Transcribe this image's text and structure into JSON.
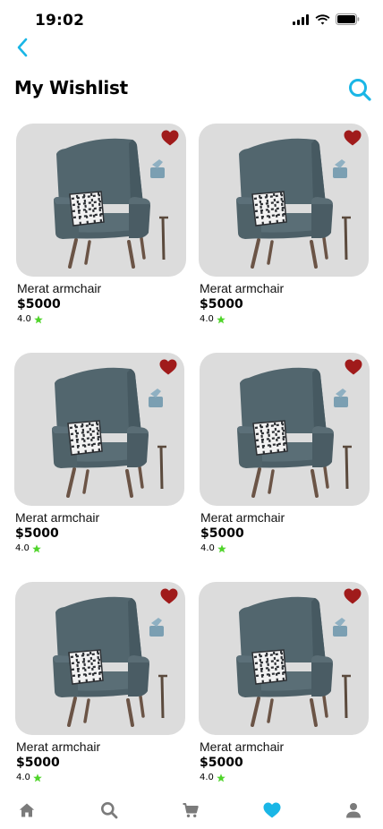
{
  "status_bar": {
    "time": "19:02"
  },
  "header": {
    "title": "My Wishlist"
  },
  "colors": {
    "accent": "#1ab6e6",
    "heart": "#a01b1b",
    "star": "#4fd42a",
    "card_bg": "#dcdcdc",
    "nav_icon": "#7b7b7b"
  },
  "products": [
    {
      "name": "Merat armchair",
      "price": "$5000",
      "rating": "4.0"
    },
    {
      "name": "Merat armchair",
      "price": "$5000",
      "rating": "4.0"
    },
    {
      "name": "Merat armchair",
      "price": "$5000",
      "rating": "4.0"
    },
    {
      "name": "Merat armchair",
      "price": "$5000",
      "rating": "4.0"
    },
    {
      "name": "Merat armchair",
      "price": "$5000",
      "rating": "4.0"
    },
    {
      "name": "Merat armchair",
      "price": "$5000",
      "rating": "4.0"
    }
  ],
  "bottom_nav": {
    "items": [
      {
        "icon": "home-icon",
        "active": false
      },
      {
        "icon": "search-icon",
        "active": false
      },
      {
        "icon": "cart-icon",
        "active": false
      },
      {
        "icon": "heart-icon",
        "active": true
      },
      {
        "icon": "profile-icon",
        "active": false
      }
    ]
  }
}
